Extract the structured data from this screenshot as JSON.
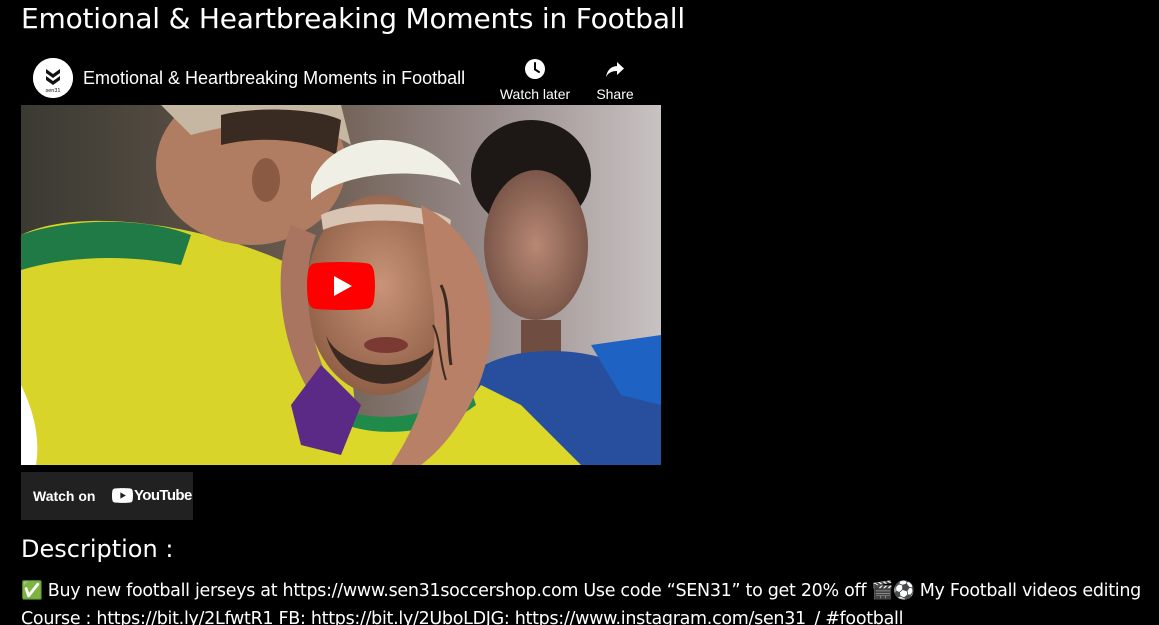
{
  "page": {
    "title": "Emotional & Heartbreaking Moments in Football"
  },
  "player": {
    "channel_avatar_text": "sen31",
    "video_title": "Emotional & Heartbreaking Moments in Football",
    "watch_later_label": "Watch later",
    "share_label": "Share",
    "thumbnail_label": "",
    "watch_on_label": "Watch on",
    "youtube_logo_text": "YouTube"
  },
  "description": {
    "heading": "Description :",
    "text": "✅ Buy new football jerseys at https://www.sen31soccershop.com Use code “SEN31” to get 20% off 🎬⚽ My Football videos editing Course : https://bit.ly/2LfwtR1 FB: https://bit.ly/2UboLDJG: https://www.instagram.com/sen31_/ #football"
  },
  "colors": {
    "background": "#000000",
    "text": "#ffffff",
    "youtube_red": "#ff0000",
    "watch_on_bg": "#212121",
    "jersey_yellow": "#e8e61e"
  },
  "icons": {
    "channel": "sen31-logo-icon",
    "watch_later": "clock-icon",
    "share": "share-arrow-icon",
    "play": "play-button-icon",
    "youtube": "youtube-logo-icon"
  }
}
